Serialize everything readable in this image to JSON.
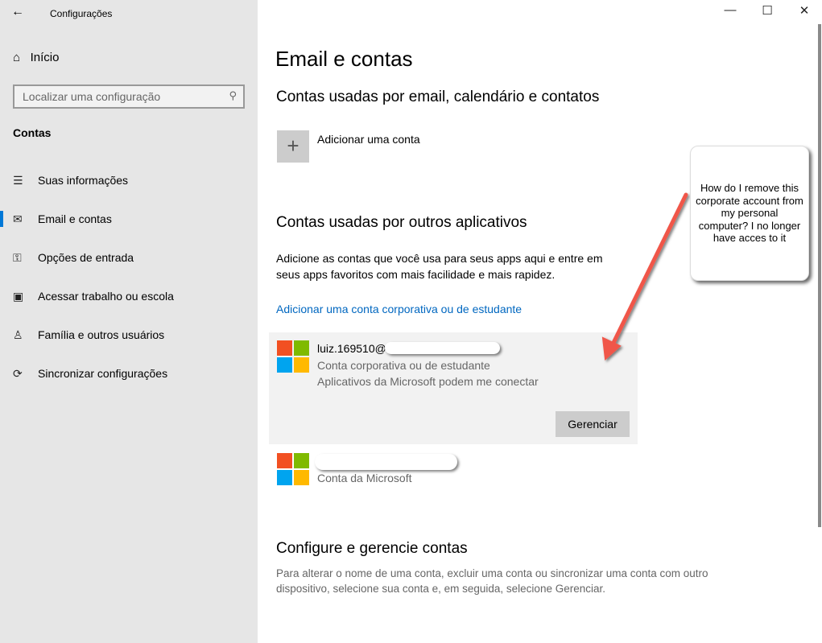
{
  "window": {
    "title": "Configurações",
    "minimize": "—",
    "maximize": "☐",
    "close": "✕"
  },
  "sidebar": {
    "home": "Início",
    "search_placeholder": "Localizar uma configuração",
    "section": "Contas",
    "items": [
      {
        "label": "Suas informações",
        "icon": "person-list-icon"
      },
      {
        "label": "Email e contas",
        "icon": "mail-icon"
      },
      {
        "label": "Opções de entrada",
        "icon": "key-icon"
      },
      {
        "label": "Acessar trabalho ou escola",
        "icon": "briefcase-icon"
      },
      {
        "label": "Família e outros usuários",
        "icon": "person-add-icon"
      },
      {
        "label": "Sincronizar configurações",
        "icon": "sync-icon"
      }
    ]
  },
  "main": {
    "title": "Email e contas",
    "section1": {
      "heading": "Contas usadas por email, calendário e contatos",
      "add": "Adicionar uma conta"
    },
    "section2": {
      "heading": "Contas usadas por outros aplicativos",
      "desc1": "Adicione as contas que você usa para seus apps aqui e entre em",
      "desc2": "seus apps favoritos com mais facilidade e mais rapidez.",
      "link": "Adicionar uma conta corporativa ou de estudante",
      "accounts": [
        {
          "email": "luiz.169510@",
          "type": "Conta corporativa ou de estudante",
          "detail": "Aplicativos da Microsoft podem me conectar",
          "button": "Gerenciar"
        },
        {
          "type": "Conta da Microsoft"
        }
      ]
    },
    "section3": {
      "heading": "Configure e gerencie contas",
      "desc1": "Para alterar o nome de uma conta, excluir uma conta ou sincronizar uma conta com outro",
      "desc2": "dispositivo, selecione sua conta e, em seguida, selecione Gerenciar."
    }
  },
  "annotation": {
    "text": "How do I remove this corporate account from my personal computer? I no longer have acces to it",
    "arrow_color": "#f0564a"
  }
}
